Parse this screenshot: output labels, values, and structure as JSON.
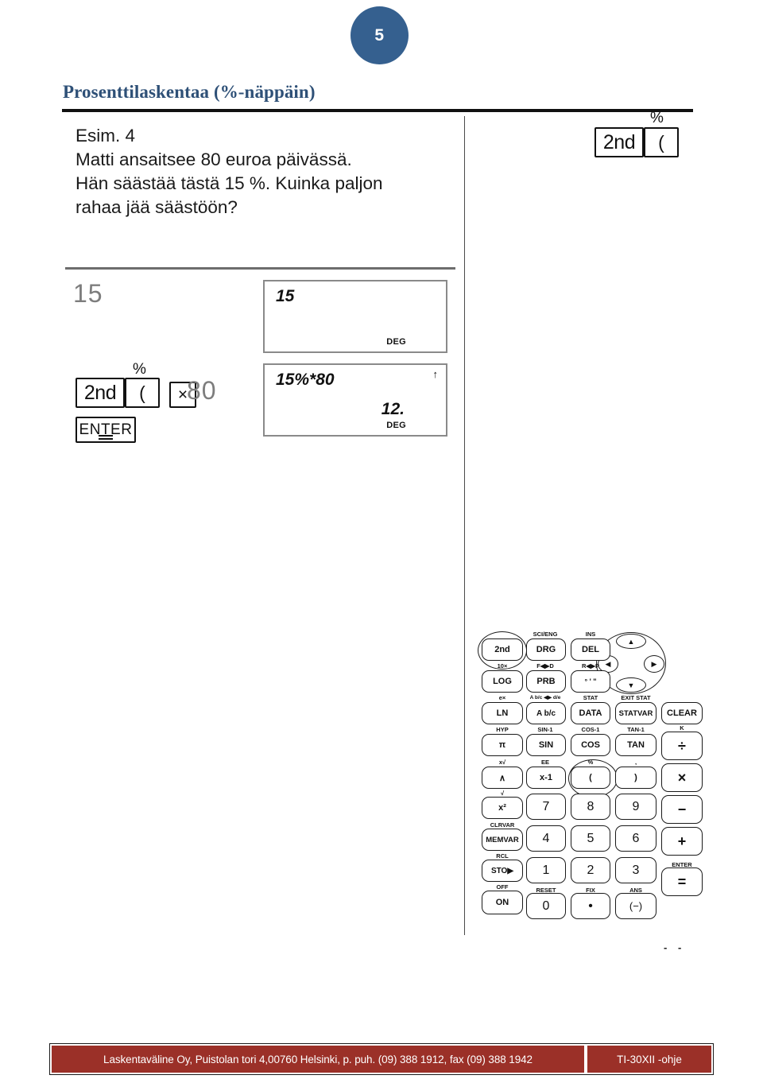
{
  "page": {
    "number": "5",
    "badge_color": "#35608F"
  },
  "title": {
    "text": "Prosenttilaskentaa (%-näppäin)",
    "color": "#2E5077"
  },
  "problem": {
    "line1": "Esim. 4",
    "line2": "Matti ansaitsee 80 euroa päivässä.",
    "line3": "Hän säästää tästä 15 %. Kuinka paljon",
    "line4": "rahaa jää säästöön?"
  },
  "keys_top": {
    "second_label": "2nd",
    "paren_label": "(",
    "percent_label": "%"
  },
  "worked_example": {
    "entry_15": "15",
    "second_label": "2nd",
    "paren_label": "(",
    "percent_label": "%",
    "times_label": "×",
    "entry_80": "80",
    "enter_label": "ENTER"
  },
  "display_1": {
    "entry": "15",
    "mode": "DEG"
  },
  "display_2": {
    "entry": "15%*80",
    "result": "12.",
    "mode": "DEG",
    "indicator": "↑"
  },
  "keypad": {
    "rows": [
      {
        "keys": [
          "2nd",
          "DRG",
          "DEL"
        ],
        "above": [
          "",
          "SCI/ENG",
          "INS"
        ]
      },
      {
        "keys": [
          "LOG",
          "PRB",
          "° ' \""
        ],
        "above": [
          "10×",
          "F◀▶D",
          "R◀▶P"
        ]
      },
      {
        "keys": [
          "LN",
          "A b/c",
          "DATA",
          "STATVAR",
          "CLEAR"
        ],
        "above": [
          "e×",
          "A b/c ◀▶ d/e",
          "STAT",
          "EXIT STAT",
          ""
        ]
      },
      {
        "keys": [
          "π",
          "SIN",
          "COS",
          "TAN",
          "÷"
        ],
        "above": [
          "HYP",
          "SIN-1",
          "COS-1",
          "TAN-1",
          "K"
        ]
      },
      {
        "keys": [
          "∧",
          "x-1",
          "(",
          ")"
        ],
        "above": [
          "x√",
          "EE",
          "%",
          ","
        ]
      },
      {
        "keys": [
          "x²",
          "7",
          "8",
          "9",
          "×"
        ],
        "above": [
          "√",
          "",
          "",
          "",
          ""
        ]
      },
      {
        "keys": [
          "MEMVAR",
          "4",
          "5",
          "6",
          "−"
        ],
        "above": [
          "CLRVAR",
          "",
          "",
          "",
          ""
        ]
      },
      {
        "keys": [
          "STO▶",
          "1",
          "2",
          "3",
          "+"
        ],
        "above": [
          "RCL",
          "",
          "",
          "",
          ""
        ]
      },
      {
        "keys": [
          "ON",
          "0",
          "•",
          "(−)",
          "="
        ],
        "above": [
          "OFF",
          "RESET",
          "FIX",
          "ANS",
          "ENTER"
        ]
      }
    ],
    "dpad": {
      "up": "▲",
      "down": "▼",
      "left": "◀",
      "right": "▶"
    }
  },
  "footer": {
    "contact": "Laskentaväline Oy, Puistolan tori 4,00760 Helsinki,  p. puh. (09) 388 1912, fax (09) 388 1942",
    "manual": "TI-30XII -ohje",
    "bar_color": "#9B3028"
  }
}
